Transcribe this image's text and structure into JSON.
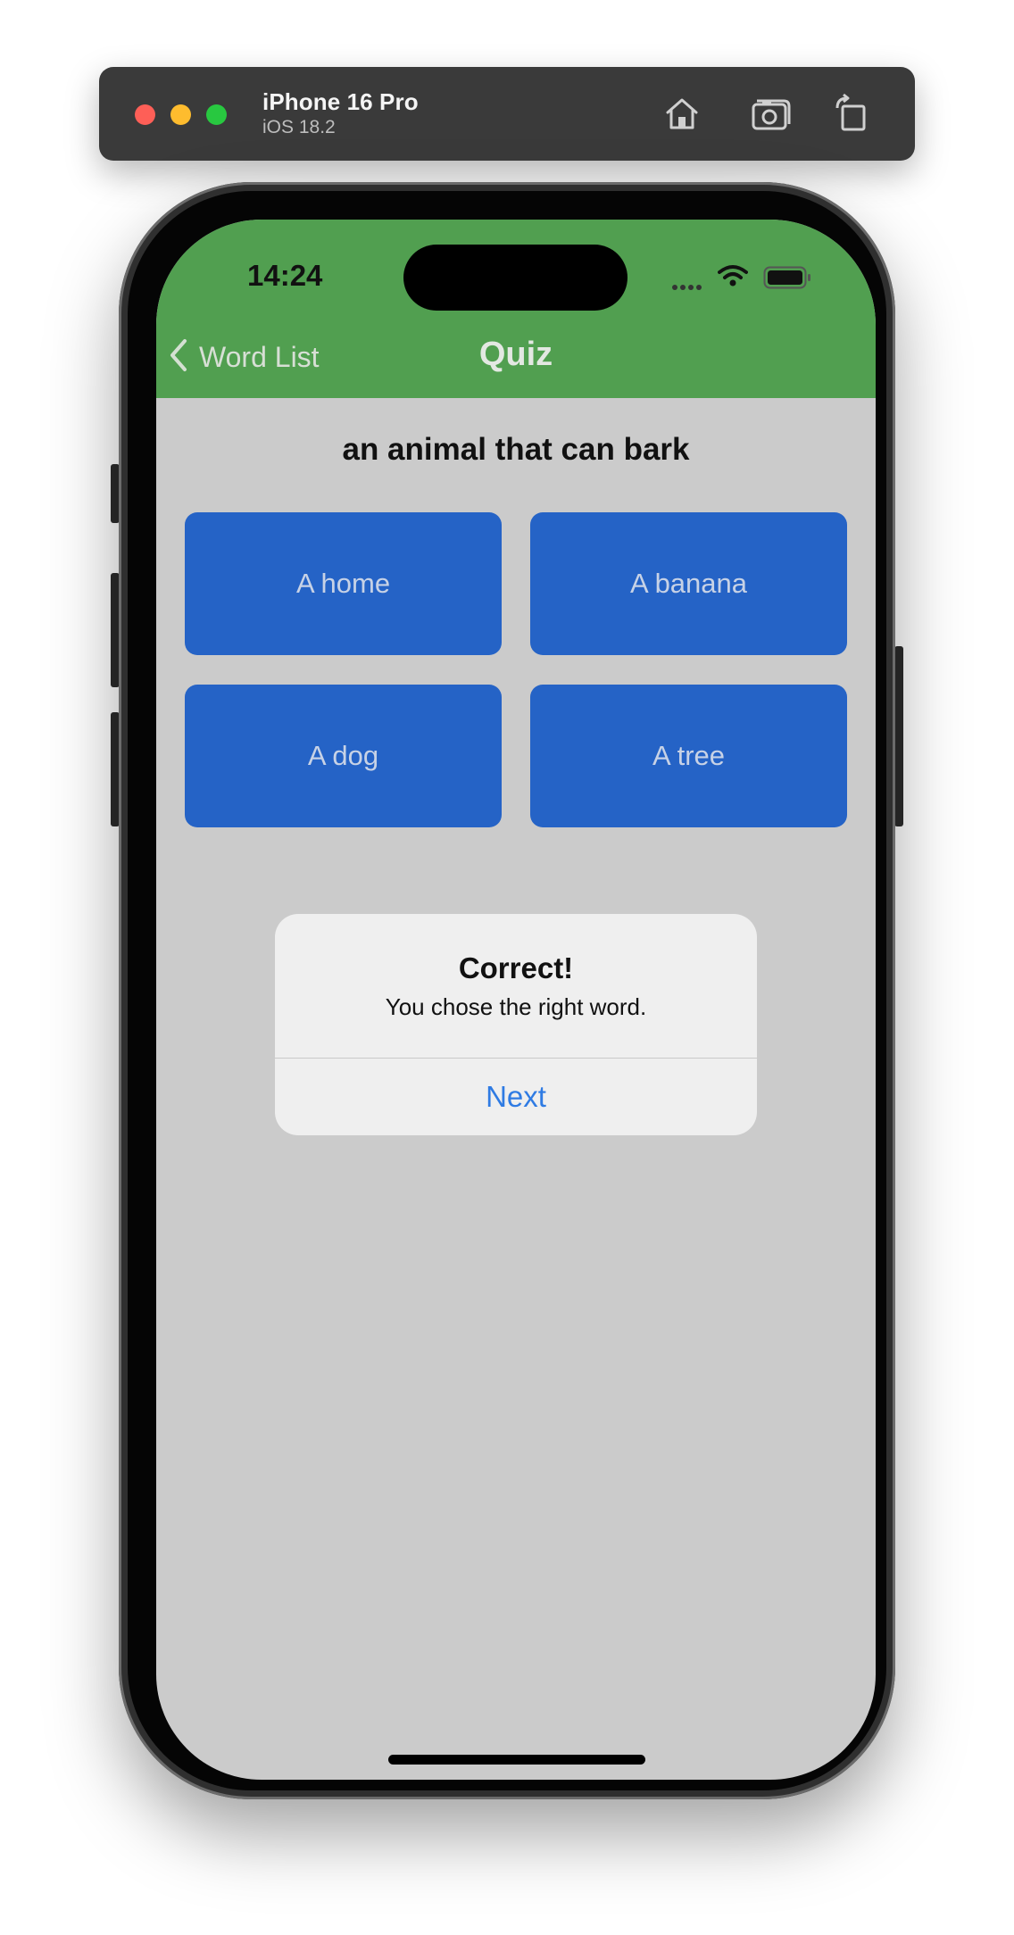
{
  "simulator": {
    "device_name": "iPhone 16 Pro",
    "os_version": "iOS 18.2",
    "icons": [
      "home-icon",
      "screenshot-icon",
      "rotate-icon"
    ]
  },
  "status_bar": {
    "time": "14:24",
    "icons": [
      "cellular-signal-icon",
      "wifi-icon",
      "battery-icon"
    ]
  },
  "nav": {
    "back_label": "Word List",
    "title": "Quiz",
    "color": "#519f50"
  },
  "quiz": {
    "question": "an animal that can bark",
    "answers": [
      "A home",
      "A banana",
      "A dog",
      "A tree"
    ],
    "button_color": "#2563c6"
  },
  "alert": {
    "title": "Correct!",
    "message": "You chose the right word.",
    "button_label": "Next",
    "button_color": "#2f7be3"
  },
  "screen_background": "#cbcbcb"
}
